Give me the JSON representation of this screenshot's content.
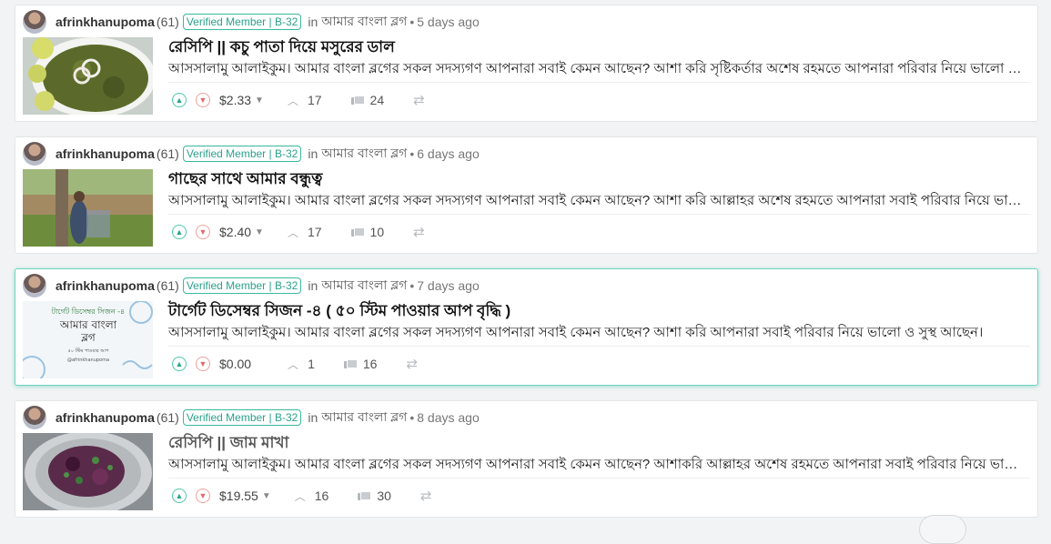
{
  "posts": [
    {
      "author": "afrinkhanupoma",
      "reputation": "(61)",
      "badge": "Verified Member | B-32",
      "in_label": "in",
      "community": "আমার বাংলা ব্লগ",
      "dot": "•",
      "time_ago": "5 days ago",
      "title": "রেসিপি || কচু পাতা দিয়ে মসুরের ডাল",
      "excerpt": "আসসালামু আলাইকুম। আমার বাংলা ব্লগের সকল সদস্যগণ আপনারা সবাই কেমন আছেন? আশা করি সৃষ্টিকর্তার অশেষ রহমতে আপনারা পরিবার নিয়ে ভালো আছেন।",
      "payout": "$2.33",
      "votes": "17",
      "comments": "24",
      "thumbnail": "green-curry-dish-photo"
    },
    {
      "author": "afrinkhanupoma",
      "reputation": "(61)",
      "badge": "Verified Member | B-32",
      "in_label": "in",
      "community": "আমার বাংলা ব্লগ",
      "dot": "•",
      "time_ago": "6 days ago",
      "title": "গাছের সাথে আমার বন্ধুত্ব",
      "excerpt": "আসসালামু আলাইকুম। আমার বাংলা ব্লগের সকল সদস্যগণ আপনারা সবাই কেমন আছেন? আশা করি আল্লাহর অশেষ রহমতে আপনারা সবাই পরিবার নিয়ে ভালো আছেন।",
      "payout": "$2.40",
      "votes": "17",
      "comments": "10",
      "thumbnail": "woman-by-tree-photo"
    },
    {
      "author": "afrinkhanupoma",
      "reputation": "(61)",
      "badge": "Verified Member | B-32",
      "in_label": "in",
      "community": "আমার বাংলা ব্লগ",
      "dot": "•",
      "time_ago": "7 days ago",
      "title": "টার্গেট ডিসেম্বর সিজন -৪ ( ৫০ স্টিম পাওয়ার আপ বৃদ্ধি )",
      "excerpt": "আসসালামু আলাইকুম। আমার বাংলা ব্লগের সকল সদস্যগণ আপনারা সবাই কেমন আছেন? আশা করি আপনারা সবাই পরিবার নিয়ে ভালো ও সুস্থ আছেন।",
      "payout": "$0.00",
      "votes": "1",
      "comments": "16",
      "thumbnail": "target-december-banner",
      "thumb_text": {
        "line1": "টার্গেট ডিসেম্বর সিজন -৪",
        "line2": "আমার বাংলা",
        "line3": "ব্লগ",
        "line4": "৫০ স্টিম পাওয়ার আপ",
        "line5": "@afrinkhanupoma"
      }
    },
    {
      "author": "afrinkhanupoma",
      "reputation": "(61)",
      "badge": "Verified Member | B-32",
      "in_label": "in",
      "community": "আমার বাংলা ব্লগ",
      "dot": "•",
      "time_ago": "8 days ago",
      "title": "রেসিপি || জাম মাখা",
      "excerpt": "আসসালামু আলাইকুম। আমার বাংলা ব্লগের সকল সদস্যগণ আপনারা সবাই কেমন আছেন? আশাকরি আল্লাহর অশেষ রহমতে আপনারা সবাই পরিবার নিয়ে ভালো আছেন।",
      "payout": "$19.55",
      "votes": "16",
      "comments": "30",
      "thumbnail": "jam-makha-plate-photo"
    }
  ],
  "icons": {
    "upvote": "▲",
    "downvote": "▼",
    "caret": "▼",
    "votes": "︿",
    "reblog": "⇄"
  },
  "colors": {
    "accent": "#38b89e",
    "downvote": "#e36a6a",
    "highlight_border": "#6fd3c0"
  }
}
